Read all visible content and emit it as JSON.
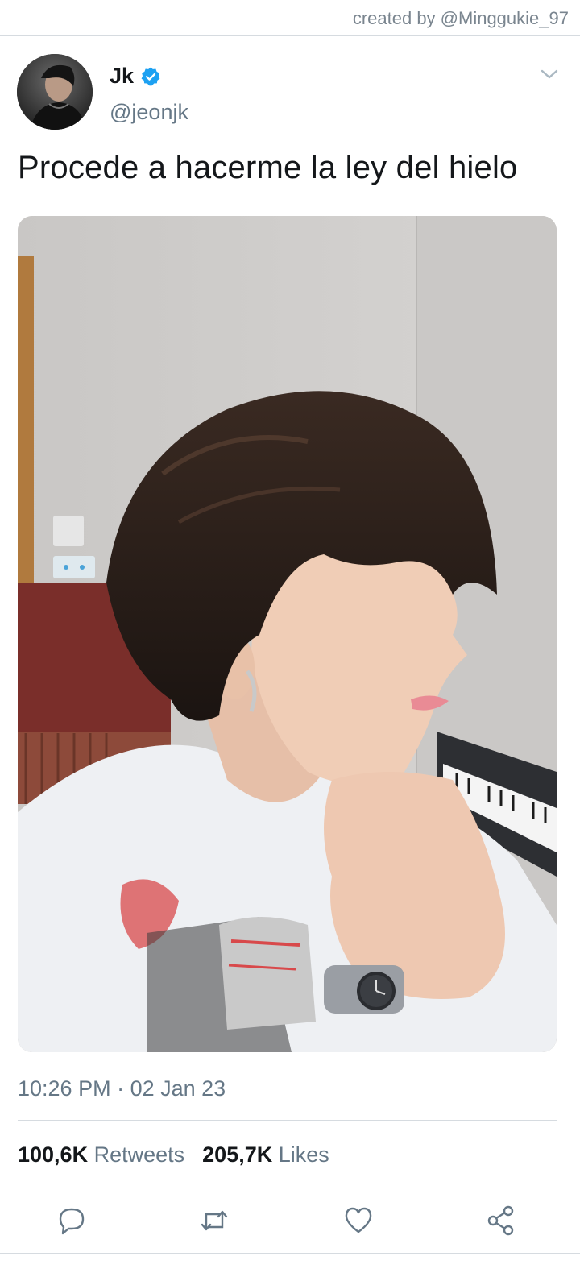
{
  "header": {
    "credit": "created by @Minggukie_97"
  },
  "author": {
    "display_name": "Jk",
    "handle": "@jeonjk",
    "verified": true,
    "avatar_icon": "profile-photo"
  },
  "tweet": {
    "text": "Procede a hacerme la ley del hielo",
    "image_icon": "tweet-photo"
  },
  "meta": {
    "time": "10:26 PM",
    "separator": " · ",
    "date": "02 Jan 23"
  },
  "stats": {
    "retweets_count": "100,6K",
    "retweets_label": "Retweets",
    "likes_count": "205,7K",
    "likes_label": "Likes"
  },
  "actions": {
    "reply_icon": "reply-icon",
    "retweet_icon": "retweet-icon",
    "like_icon": "heart-icon",
    "share_icon": "share-icon"
  },
  "colors": {
    "accent": "#1da1f2",
    "secondary_text": "#657786",
    "divider": "#d6dbe0"
  }
}
